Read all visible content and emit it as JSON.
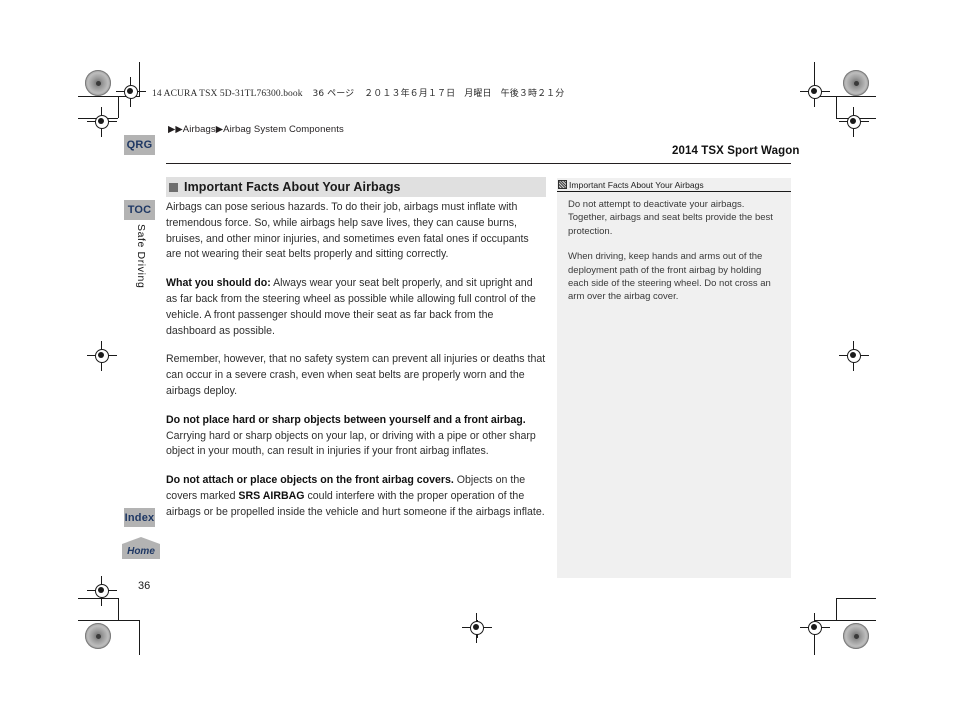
{
  "print_info": {
    "file_line_ascii": "14 ACURA TSX 5D-31TL76300.book",
    "page_marker": "36 ページ",
    "date_jp": "２０１３年６月１７日　月曜日　午後３時２１分"
  },
  "header": {
    "breadcrumb": "▶▶Airbags▶Airbag System Components",
    "model_title": "2014 TSX Sport Wagon"
  },
  "sidebar_tabs": {
    "qrg": "QRG",
    "toc": "TOC",
    "section_label": "Safe Driving",
    "index": "Index",
    "home": "Home"
  },
  "main": {
    "section_title": "Important Facts About Your Airbags",
    "paragraphs": [
      {
        "lead": "",
        "text": "Airbags can pose serious hazards. To do their job, airbags must inflate with tremendous force. So, while airbags help save lives, they can cause burns, bruises, and other minor injuries, and sometimes even fatal ones if occupants are not wearing their seat belts properly and sitting correctly."
      },
      {
        "lead": "What you should do:",
        "text": " Always wear your seat belt properly, and sit upright and as far back from the steering wheel as possible while allowing full control of the vehicle. A front passenger should move their seat as far back from the dashboard as possible."
      },
      {
        "lead": "",
        "text": "Remember, however, that no safety system can prevent all injuries or deaths that can occur in a severe crash, even when seat belts are properly worn and the airbags deploy."
      },
      {
        "lead": "Do not place hard or sharp objects between yourself and a front airbag.",
        "text": " Carrying hard or sharp objects on your lap, or driving with a pipe or other sharp object in your mouth, can result in injuries if your front airbag inflates."
      },
      {
        "lead": "Do not attach or place objects on the front airbag covers.",
        "text_a": " Objects on the covers marked ",
        "inline_bold": "SRS AIRBAG",
        "text_b": " could interfere with the proper operation of the airbags or be propelled inside the vehicle and hurt someone if the airbags inflate."
      }
    ]
  },
  "info_panel": {
    "title": "Important Facts About Your Airbags",
    "icon": "book-reference-icon",
    "paragraphs": [
      "Do not attempt to deactivate your airbags. Together, airbags and seat belts provide the best protection.",
      "When driving, keep hands and arms out of the deployment path of the front airbag by holding each side of the steering wheel. Do not cross an arm over the airbag cover."
    ]
  },
  "footer": {
    "page_number": "36"
  },
  "colors": {
    "tab_bg": "#b3b3b3",
    "tab_text": "#1f3864",
    "section_head_bg": "#e0e0e0",
    "panel_bg": "#f0f0f0",
    "rule": "#231f20"
  }
}
